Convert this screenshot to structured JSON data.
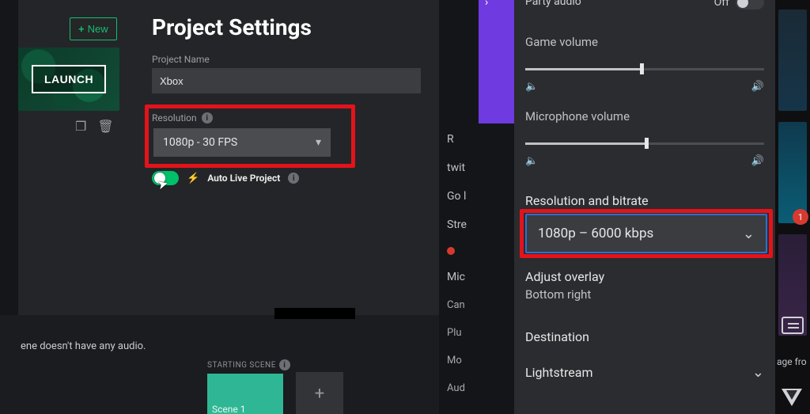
{
  "left": {
    "new_btn": "New",
    "title": "Project Settings",
    "project_name_label": "Project Name",
    "project_name_value": "Xbox",
    "launch": "LAUNCH",
    "resolution_label": "Resolution",
    "resolution_value": "1080p - 30 FPS",
    "auto_live": "Auto Live Project",
    "no_audio": "ene doesn't have any audio.",
    "starting_scene": "STARTING SCENE",
    "scene1": "Scene 1"
  },
  "mid": {
    "items": [
      "R",
      "twit",
      "Go l",
      "Stre",
      "Mic",
      "Can",
      "Plu",
      "Mo",
      "Aud"
    ]
  },
  "right": {
    "party_audio": "Party audio",
    "party_state": "Off",
    "game_volume": "Game volume",
    "mic_volume": "Microphone volume",
    "rb_label": "Resolution and bitrate",
    "rb_value": "1080p – 6000 kbps",
    "adjust": "Adjust overlay",
    "adjust_sub": "Bottom right",
    "destination": "Destination",
    "lightstream": "Lightstream"
  },
  "far": {
    "badge": "1",
    "age": "age fro"
  }
}
